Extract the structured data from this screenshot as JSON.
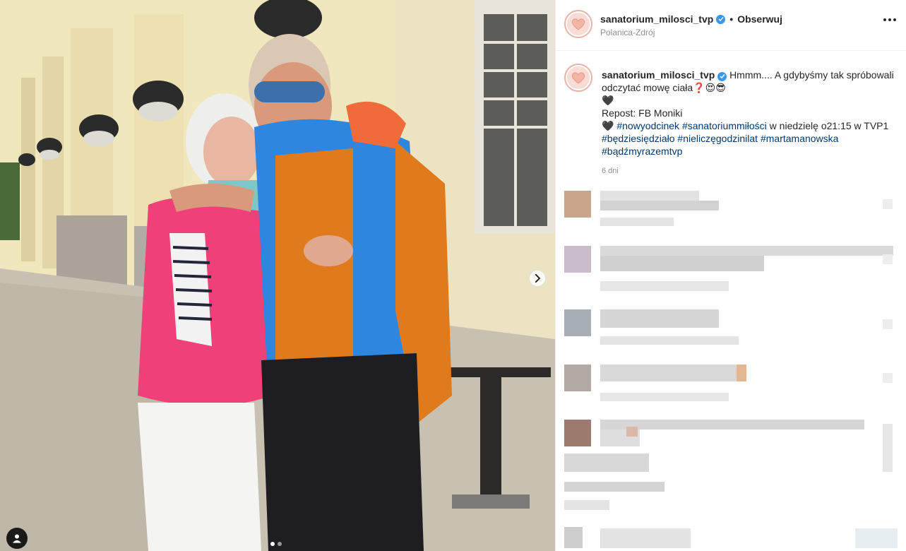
{
  "post": {
    "username": "sanatorium_milosci_tvp",
    "follow_label": "Obserwuj",
    "location": "Polanica-Zdrój",
    "caption": {
      "line1": "Hmmm.... A gdybyśmy tak spróbowali",
      "line2": "odczytać mowę ciała",
      "line2_emoji": "❓😍😎",
      "heart": "🖤",
      "repost": "Repost: FB Moniki",
      "line5_tag1": "#nowyodcinek",
      "line5_tag2": "#sanatoriummiłości",
      "line5_rest": " w niedzielę o21:15 w TVP1",
      "line6_tag1": "#będziesiędziało",
      "line6_tag2": "#nieliczęgodzinilat",
      "line6_tag3": "#martamanowska",
      "line7_tag1": "#bądźmyrazemtvp"
    },
    "time_ago": "6 dni"
  },
  "icons": {
    "verified": "verified-badge-icon",
    "more": "more-options-icon",
    "next": "chevron-right-icon",
    "user_tag": "user-tag-icon"
  },
  "colors": {
    "link": "#00376b",
    "verified": "#3897f0",
    "muted": "#8e8e8e"
  },
  "carousel": {
    "count": 2,
    "active": 1
  }
}
